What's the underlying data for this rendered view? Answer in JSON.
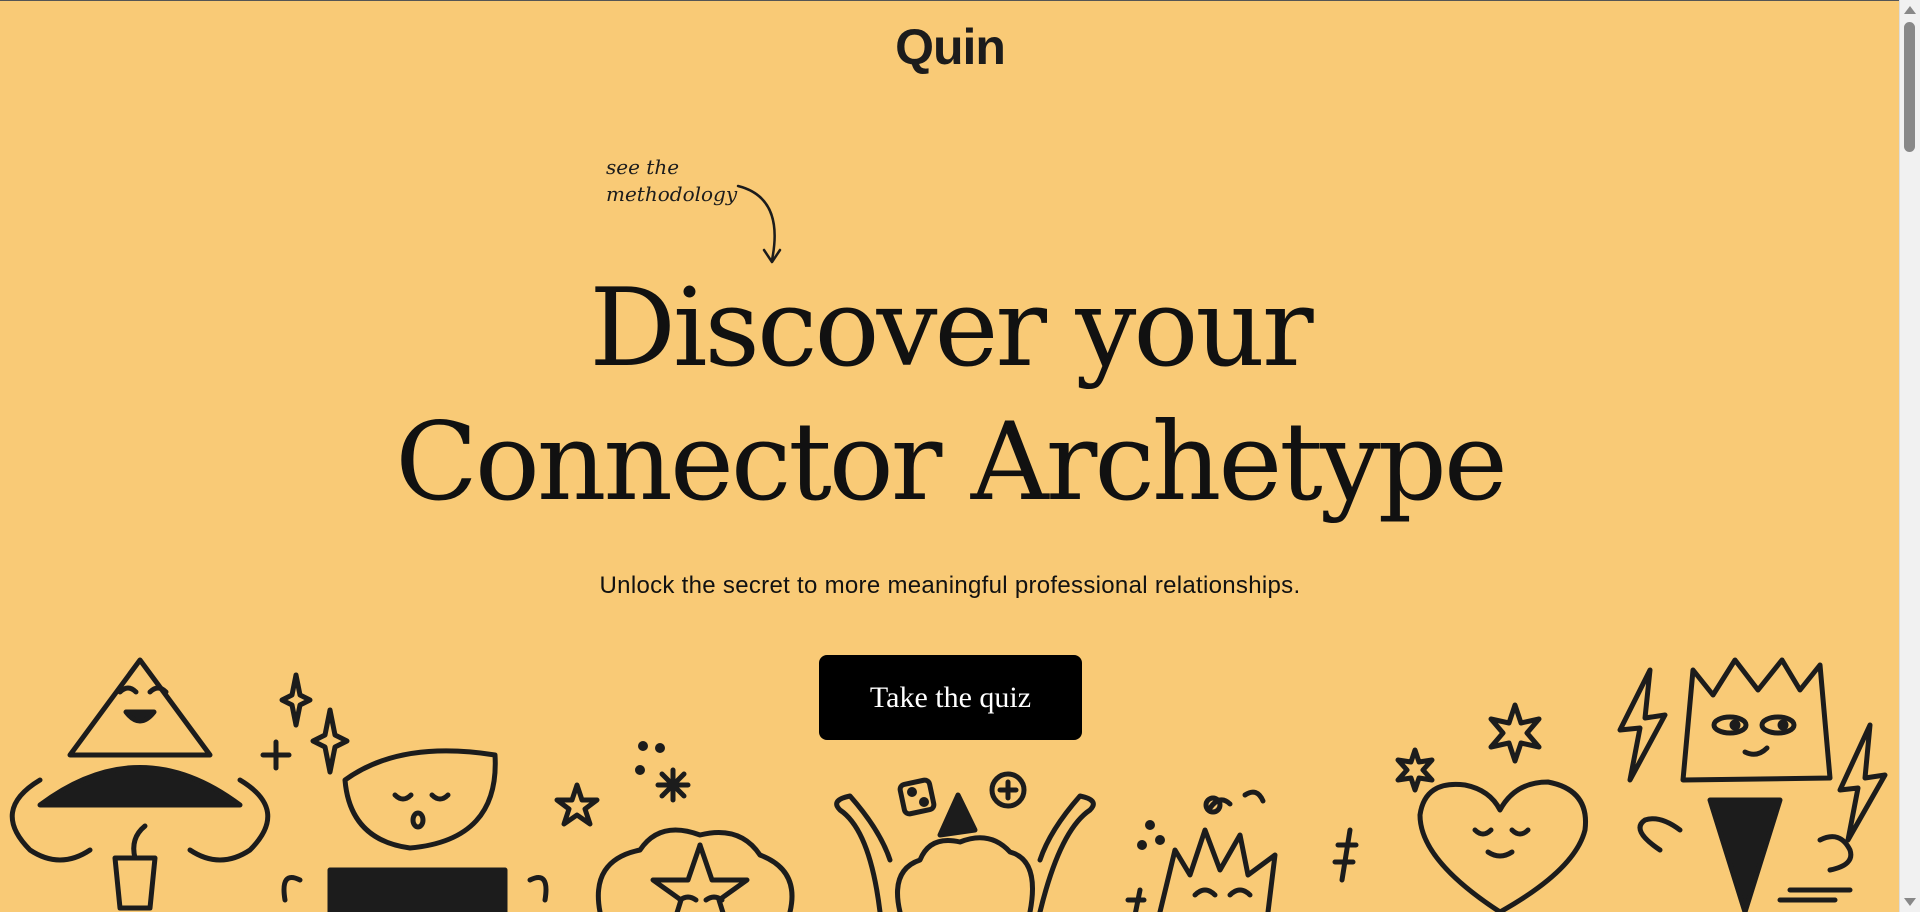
{
  "header": {
    "logo_text": "Quin"
  },
  "hero": {
    "methodology_line1": "see the",
    "methodology_line2": "methodology",
    "headline_line1": "Discover your",
    "headline_line2": "Connector Archetype",
    "subtitle": "Unlock the secret to more meaningful professional relationships.",
    "cta_label": "Take the quiz"
  },
  "colors": {
    "background": "#f9ca76",
    "button": "#000000",
    "button_text": "#ffffff",
    "ink": "#1c1c1c"
  },
  "icons": {
    "methodology_arrow": "curved-arrow-down-icon",
    "decorations": [
      "triangle-character-icon",
      "half-moon-character-icon",
      "flower-character-icon",
      "cloud-character-icon",
      "sun-character-icon",
      "heart-character-icon",
      "crown-character-icon",
      "sparkle-icon",
      "star-icon",
      "lightning-icon"
    ]
  }
}
